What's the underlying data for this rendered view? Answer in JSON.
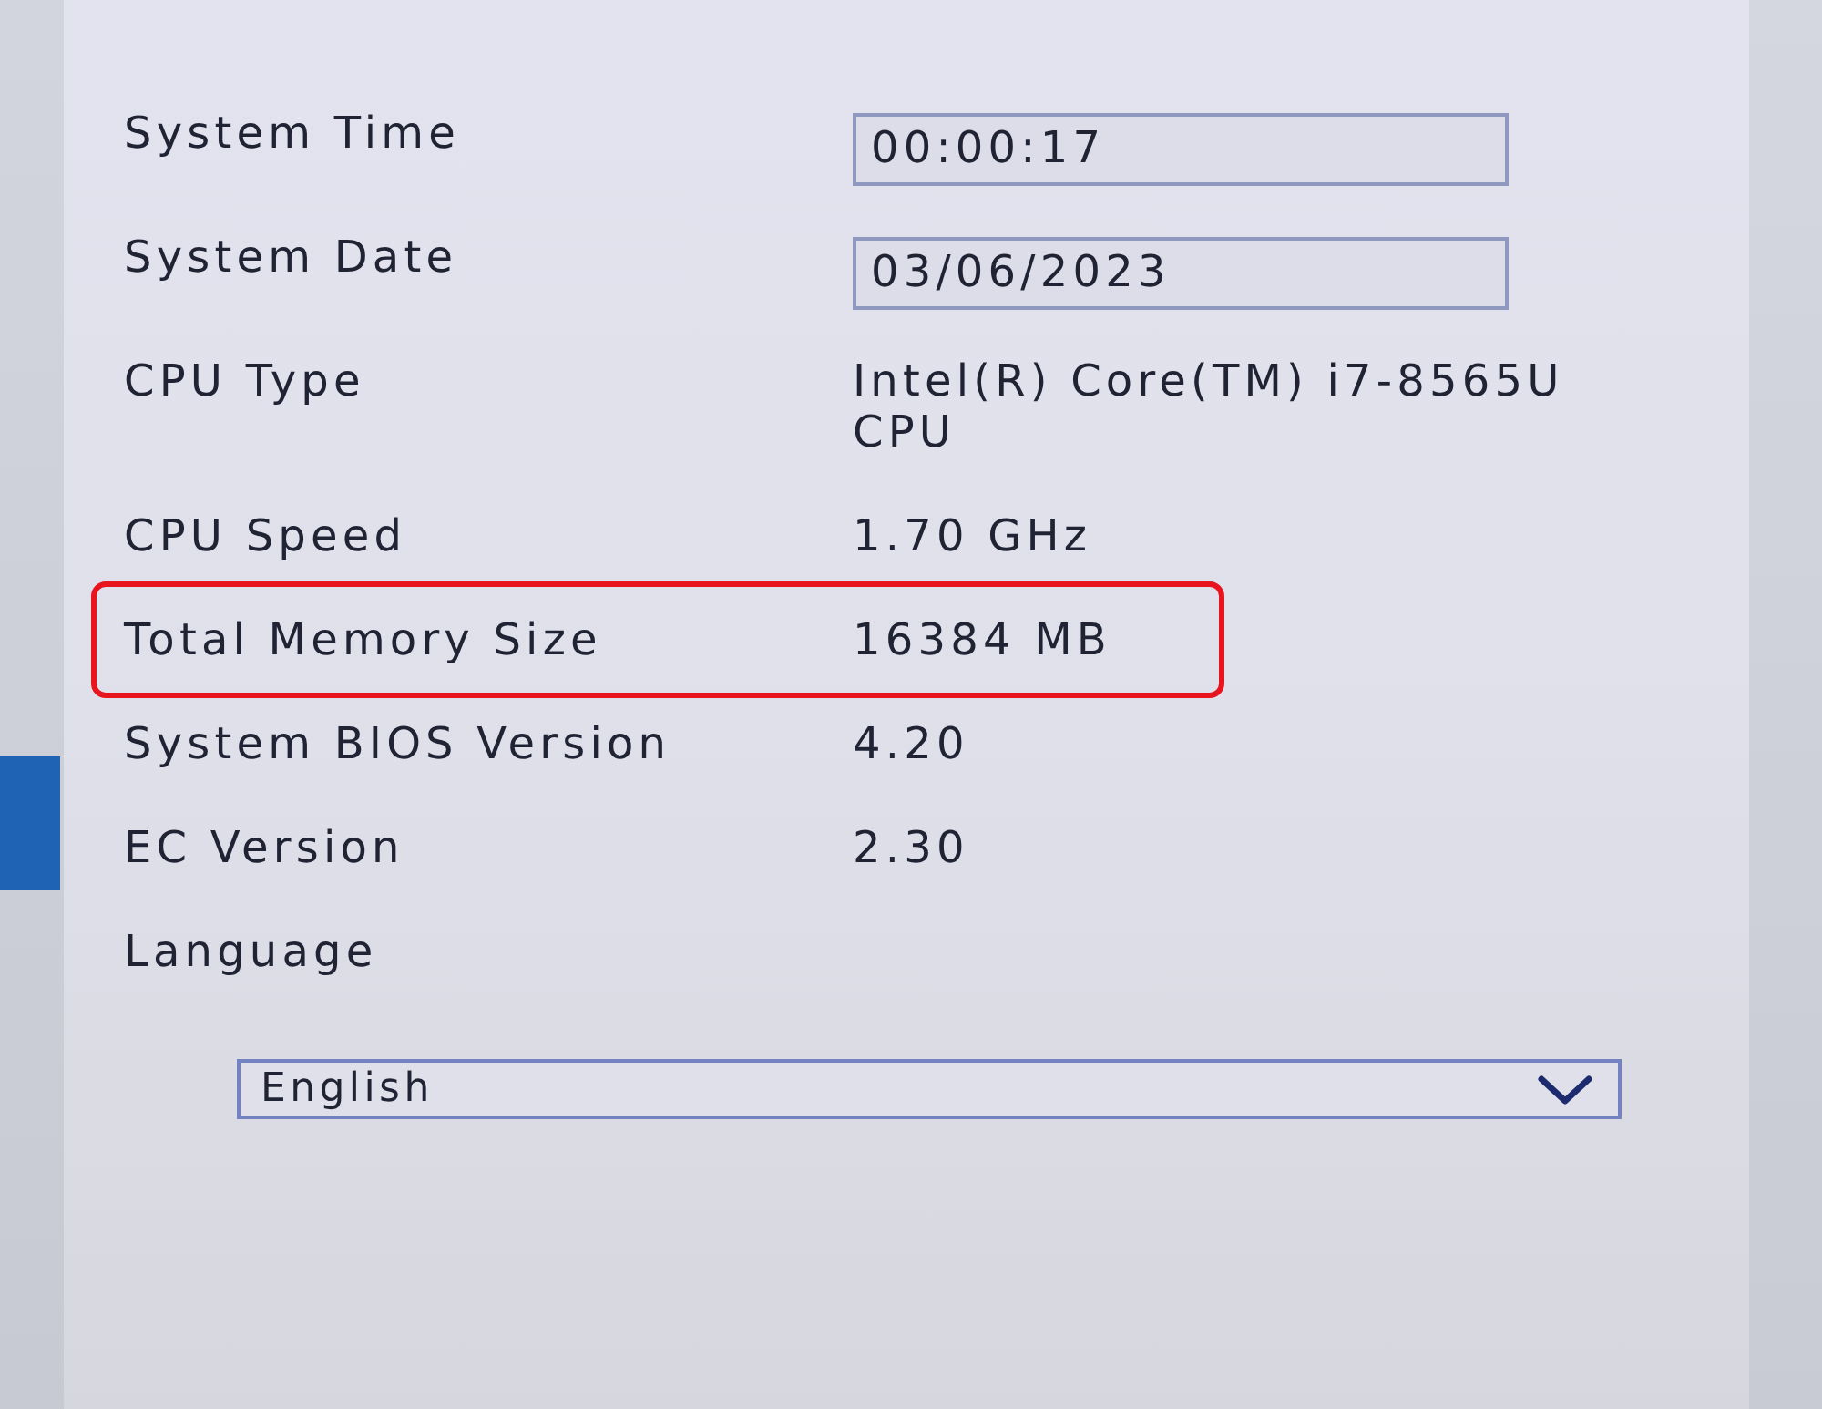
{
  "settings": [
    {
      "label": "System Time",
      "kind": "field",
      "value": "00:00:17",
      "highlighted": false
    },
    {
      "label": "System Date",
      "kind": "field",
      "value": "03/06/2023",
      "highlighted": false
    },
    {
      "label": "CPU Type",
      "kind": "text",
      "value": "Intel(R) Core(TM) i7-8565U CPU",
      "highlighted": false
    },
    {
      "label": "CPU Speed",
      "kind": "text",
      "value": "1.70 GHz",
      "highlighted": false
    },
    {
      "label": "Total Memory Size",
      "kind": "text",
      "value": "16384 MB",
      "highlighted": true
    },
    {
      "label": "System BIOS Version",
      "kind": "text",
      "value": "4.20",
      "highlighted": false
    },
    {
      "label": "EC Version",
      "kind": "text",
      "value": "2.30",
      "highlighted": false
    }
  ],
  "language": {
    "label": "Language",
    "dropdown": {
      "value": "English"
    }
  }
}
